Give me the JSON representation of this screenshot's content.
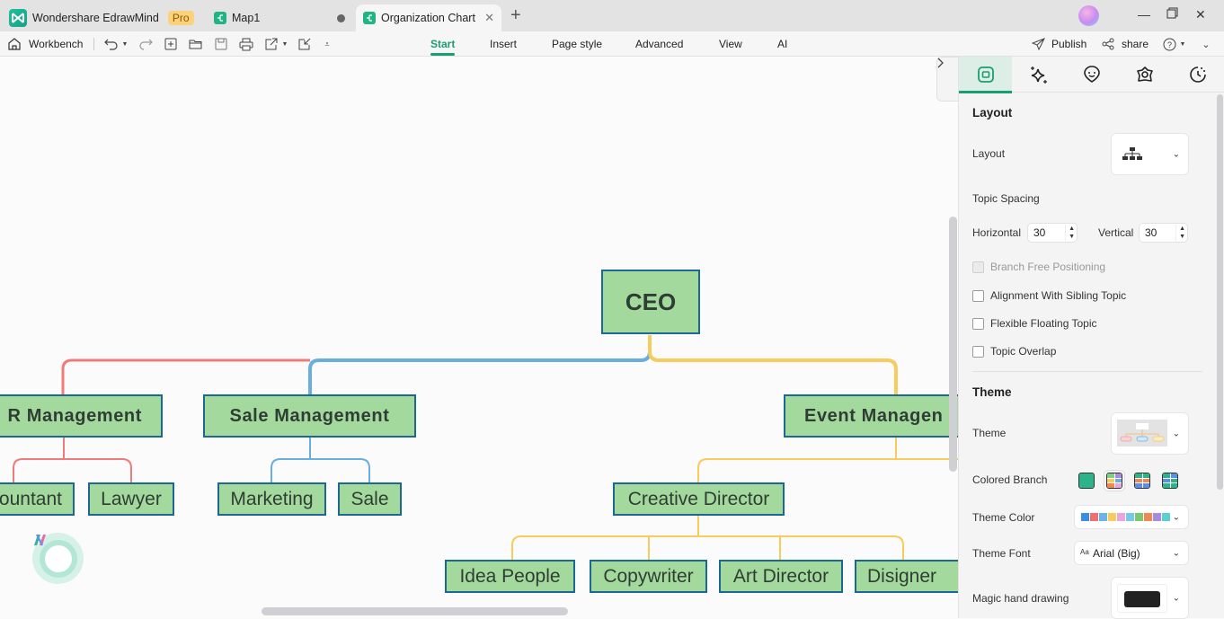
{
  "titlebar": {
    "app_name": "Wondershare EdrawMind",
    "pro_badge": "Pro",
    "tabs": [
      {
        "label": "Map1",
        "unsaved": true
      },
      {
        "label": "Organization Chart",
        "active": true
      }
    ]
  },
  "toolbar": {
    "workbench_label": "Workbench",
    "icons": [
      "undo-icon",
      "redo-icon",
      "new-icon",
      "open-folder-icon",
      "save-icon",
      "print-icon",
      "export-icon",
      "import-icon",
      "more-icon"
    ],
    "menu_tabs": [
      {
        "label": "Start",
        "active": true
      },
      {
        "label": "Insert"
      },
      {
        "label": "Page style"
      },
      {
        "label": "Advanced"
      },
      {
        "label": "View"
      },
      {
        "label": "AI"
      }
    ],
    "publish_label": "Publish",
    "share_label": "share"
  },
  "org_chart": {
    "root": "CEO",
    "branches": [
      {
        "label": "HR Management",
        "visible_label": "R Management",
        "color": "#f07b7b",
        "children": [
          {
            "label": "Accountant",
            "visible_label": "ountant"
          },
          {
            "label": "Lawyer"
          }
        ]
      },
      {
        "label": "Sale Management",
        "color": "#6aaee0",
        "children": [
          {
            "label": "Marketing"
          },
          {
            "label": "Sale"
          }
        ]
      },
      {
        "label": "Event Management",
        "visible_label": "Event Managen",
        "color": "#f7cc5c",
        "children": [
          {
            "label": "Creative Director",
            "children": [
              {
                "label": "Idea People"
              },
              {
                "label": "Copywriter"
              },
              {
                "label": "Art Director"
              },
              {
                "label": "Disigner"
              }
            ]
          }
        ]
      }
    ]
  },
  "panel": {
    "tabs": [
      "layout-tab",
      "ai-style-tab",
      "emoji-tab",
      "theme-tab",
      "history-tab"
    ],
    "layout_section": "Layout",
    "layout_label": "Layout",
    "topic_spacing_label": "Topic Spacing",
    "horizontal_label": "Horizontal",
    "horizontal_value": "30",
    "vertical_label": "Vertical",
    "vertical_value": "30",
    "checkboxes": [
      {
        "label": "Branch Free Positioning",
        "checked": false,
        "disabled": true
      },
      {
        "label": "Alignment With Sibling Topic",
        "checked": false
      },
      {
        "label": "Flexible Floating Topic",
        "checked": false
      },
      {
        "label": "Topic Overlap",
        "checked": false
      }
    ],
    "theme_section": "Theme",
    "theme_label": "Theme",
    "colored_branch_label": "Colored Branch",
    "colored_branch_selected": 1,
    "theme_color_label": "Theme Color",
    "theme_colors": [
      "#3a8fe0",
      "#f07070",
      "#6ab4ea",
      "#f7cc5c",
      "#eaa6dc",
      "#78c8e8",
      "#7cc870",
      "#f08850",
      "#a88ae0",
      "#5ad0d0"
    ],
    "theme_font_label": "Theme Font",
    "theme_font_prefix": "Aa",
    "theme_font_value": "Arial (Big)",
    "magic_hand_label": "Magic hand drawing",
    "magic_hand_color": "#222222"
  }
}
